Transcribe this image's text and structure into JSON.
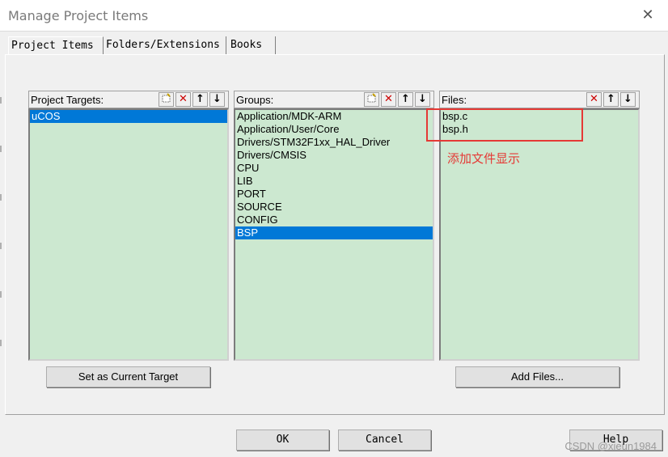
{
  "window": {
    "title": "Manage Project Items",
    "close_glyph": "✕"
  },
  "tabs": [
    {
      "label": "Project Items",
      "active": true
    },
    {
      "label": "Folders/Extensions",
      "active": false
    },
    {
      "label": "Books",
      "active": false
    }
  ],
  "targets": {
    "label": "Project Targets:",
    "items": [
      "uCOS"
    ],
    "selected": "uCOS",
    "button": "Set as Current Target"
  },
  "groups": {
    "label": "Groups:",
    "items": [
      "Application/MDK-ARM",
      "Application/User/Core",
      "Drivers/STM32F1xx_HAL_Driver",
      "Drivers/CMSIS",
      "CPU",
      "LIB",
      "PORT",
      "SOURCE",
      "CONFIG",
      "BSP"
    ],
    "selected": "BSP"
  },
  "files": {
    "label": "Files:",
    "items": [
      "bsp.c",
      "bsp.h"
    ],
    "button": "Add Files..."
  },
  "toolbar_icons": {
    "new": "new-item-icon",
    "delete": "delete-icon",
    "up": "move-up-icon",
    "down": "move-down-icon"
  },
  "annotation": {
    "text": "添加文件显示",
    "color": "#e53935"
  },
  "footer": {
    "ok": "OK",
    "cancel": "Cancel",
    "help": "Help"
  },
  "watermark": "CSDN @xieun1984",
  "colors": {
    "list_bg": "#cce8d0",
    "selection": "#0078d7"
  }
}
